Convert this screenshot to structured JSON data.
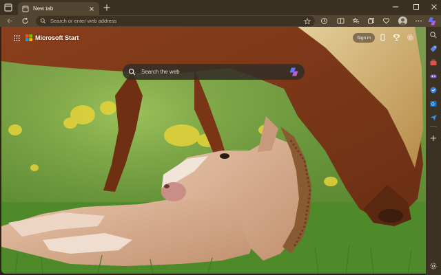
{
  "browser": {
    "tab": {
      "title": "New tab"
    },
    "address_bar": {
      "placeholder": "Search or enter web address"
    }
  },
  "page": {
    "brand": "Microsoft Start",
    "signin_label": "Sign in",
    "search_placeholder": "Search the web"
  },
  "colors": {
    "chrome": "#3a3122",
    "toolbar": "#524531",
    "sidebar": "#3b3224",
    "grass": "#5f8e35",
    "horse": "#8e4a25",
    "foal": "#d8ab8c"
  }
}
